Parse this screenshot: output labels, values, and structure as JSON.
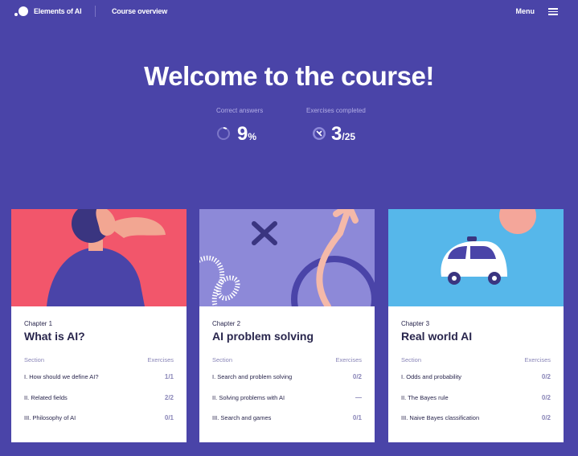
{
  "header": {
    "brand": "Elements of AI",
    "nav_link": "Course overview",
    "menu_label": "Menu"
  },
  "hero": {
    "title": "Welcome to the course!",
    "stats": [
      {
        "label": "Correct answers",
        "value": "9",
        "unit": "%",
        "progress": 0.09
      },
      {
        "label": "Exercises completed",
        "value": "3",
        "unit": "/25",
        "progress": 0.12
      }
    ]
  },
  "table_headers": {
    "section": "Section",
    "exercises": "Exercises"
  },
  "chapters": [
    {
      "label": "Chapter 1",
      "title": "What is AI?",
      "color": "#f2566b",
      "sections": [
        {
          "name": "I. How should we define AI?",
          "score": "1/1"
        },
        {
          "name": "II. Related fields",
          "score": "2/2"
        },
        {
          "name": "III. Philosophy of AI",
          "score": "0/1"
        }
      ]
    },
    {
      "label": "Chapter 2",
      "title": "AI problem solving",
      "color": "#8d89d8",
      "sections": [
        {
          "name": "I. Search and problem solving",
          "score": "0/2"
        },
        {
          "name": "II. Solving problems with AI",
          "score": "—"
        },
        {
          "name": "III. Search and games",
          "score": "0/1"
        }
      ]
    },
    {
      "label": "Chapter 3",
      "title": "Real world AI",
      "color": "#56b7ea",
      "sections": [
        {
          "name": "I. Odds and probability",
          "score": "0/2"
        },
        {
          "name": "II. The Bayes rule",
          "score": "0/2"
        },
        {
          "name": "III. Naive Bayes classification",
          "score": "0/2"
        }
      ]
    }
  ],
  "colors": {
    "background": "#4a44a8",
    "text_dark": "#29264d",
    "muted": "#8a86b8",
    "stat_label": "#b3aee6"
  }
}
